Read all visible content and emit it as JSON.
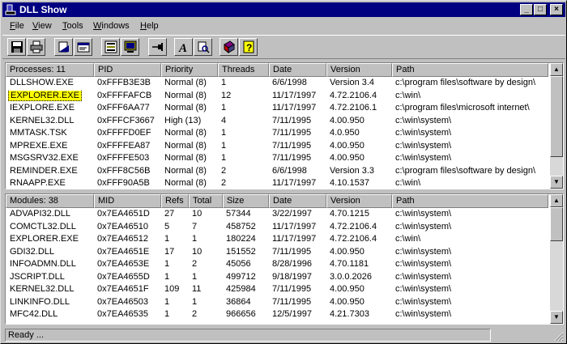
{
  "app": {
    "title": "DLL Show",
    "window_buttons": [
      "_",
      "□",
      "×"
    ]
  },
  "menu": [
    {
      "label": "File",
      "key": "F",
      "rest": "ile"
    },
    {
      "label": "View",
      "key": "V",
      "rest": "iew"
    },
    {
      "label": "Tools",
      "key": "T",
      "rest": "ools"
    },
    {
      "label": "Windows",
      "key": "W",
      "rest": "indows"
    },
    {
      "label": "Help",
      "key": "H",
      "rest": "elp"
    }
  ],
  "toolbar": {
    "icons": [
      "save-icon",
      "print-icon",
      "print-preview-icon",
      "properties-icon",
      "process-list-icon",
      "monitor-icon",
      "pin-icon",
      "font-icon",
      "find-icon",
      "book-icon",
      "help-icon"
    ]
  },
  "processes": {
    "headers": [
      "Processes: 11",
      "PID",
      "Priority",
      "Threads",
      "Date",
      "Version",
      "Path"
    ],
    "rows": [
      [
        "DLLSHOW.EXE",
        "0xFFFB3E3B",
        "Normal (8)",
        "1",
        "6/6/1998",
        "Version 3.4",
        "c:\\program files\\software by design\\"
      ],
      [
        "EXPLORER.EXE",
        "0xFFFFAFCB",
        "Normal (8)",
        "12",
        "11/17/1997",
        "4.72.2106.4",
        "c:\\win\\"
      ],
      [
        "IEXPLORE.EXE",
        "0xFFF6AA77",
        "Normal (8)",
        "1",
        "11/17/1997",
        "4.72.2106.1",
        "c:\\program files\\microsoft internet\\"
      ],
      [
        "KERNEL32.DLL",
        "0xFFFCF3667",
        "High (13)",
        "4",
        "7/11/1995",
        "4.00.950",
        "c:\\win\\system\\"
      ],
      [
        "MMTASK.TSK",
        "0xFFFFD0EF",
        "Normal (8)",
        "1",
        "7/11/1995",
        "4.0.950",
        "c:\\win\\system\\"
      ],
      [
        "MPREXE.EXE",
        "0xFFFFEA87",
        "Normal (8)",
        "1",
        "7/11/1995",
        "4.00.950",
        "c:\\win\\system\\"
      ],
      [
        "MSGSRV32.EXE",
        "0xFFFFE503",
        "Normal (8)",
        "1",
        "7/11/1995",
        "4.00.950",
        "c:\\win\\system\\"
      ],
      [
        "REMINDER.EXE",
        "0xFFF8C56B",
        "Normal (8)",
        "2",
        "6/6/1998",
        "Version 3.3",
        "c:\\program files\\software by design\\"
      ],
      [
        "RNAAPP.EXE",
        "0xFFF90A5B",
        "Normal (8)",
        "2",
        "11/17/1997",
        "4.10.1537",
        "c:\\win\\"
      ]
    ],
    "highlighted_row": 1
  },
  "modules": {
    "headers": [
      "Modules: 38",
      "MID",
      "Refs",
      "Total",
      "Size",
      "Date",
      "Version",
      "Path"
    ],
    "rows": [
      [
        "ADVAPI32.DLL",
        "0x7EA4651D",
        "27",
        "10",
        "57344",
        "3/22/1997",
        "4.70.1215",
        "c:\\win\\system\\"
      ],
      [
        "COMCTL32.DLL",
        "0x7EA46510",
        "5",
        "7",
        "458752",
        "11/17/1997",
        "4.72.2106.4",
        "c:\\win\\system\\"
      ],
      [
        "EXPLORER.EXE",
        "0x7EA46512",
        "1",
        "1",
        "180224",
        "11/17/1997",
        "4.72.2106.4",
        "c:\\win\\"
      ],
      [
        "GDI32.DLL",
        "0x7EA4651E",
        "17",
        "10",
        "151552",
        "7/11/1995",
        "4.00.950",
        "c:\\win\\system\\"
      ],
      [
        "INFOADMN.DLL",
        "0x7EA4653E",
        "1",
        "2",
        "45056",
        "8/28/1996",
        "4.70.1181",
        "c:\\win\\system\\"
      ],
      [
        "JSCRIPT.DLL",
        "0x7EA4655D",
        "1",
        "1",
        "499712",
        "9/18/1997",
        "3.0.0.2026",
        "c:\\win\\system\\"
      ],
      [
        "KERNEL32.DLL",
        "0x7EA4651F",
        "109",
        "11",
        "425984",
        "7/11/1995",
        "4.00.950",
        "c:\\win\\system\\"
      ],
      [
        "LINKINFO.DLL",
        "0x7EA46503",
        "1",
        "1",
        "36864",
        "7/11/1995",
        "4.00.950",
        "c:\\win\\system\\"
      ],
      [
        "MFC42.DLL",
        "0x7EA46535",
        "1",
        "2",
        "966656",
        "12/5/1997",
        "4.21.7303",
        "c:\\win\\system\\"
      ]
    ]
  },
  "status": {
    "text": "Ready ..."
  },
  "colors": {
    "titlebar": "#000080",
    "highlight": "#ffff00",
    "face": "#c0c0c0"
  }
}
